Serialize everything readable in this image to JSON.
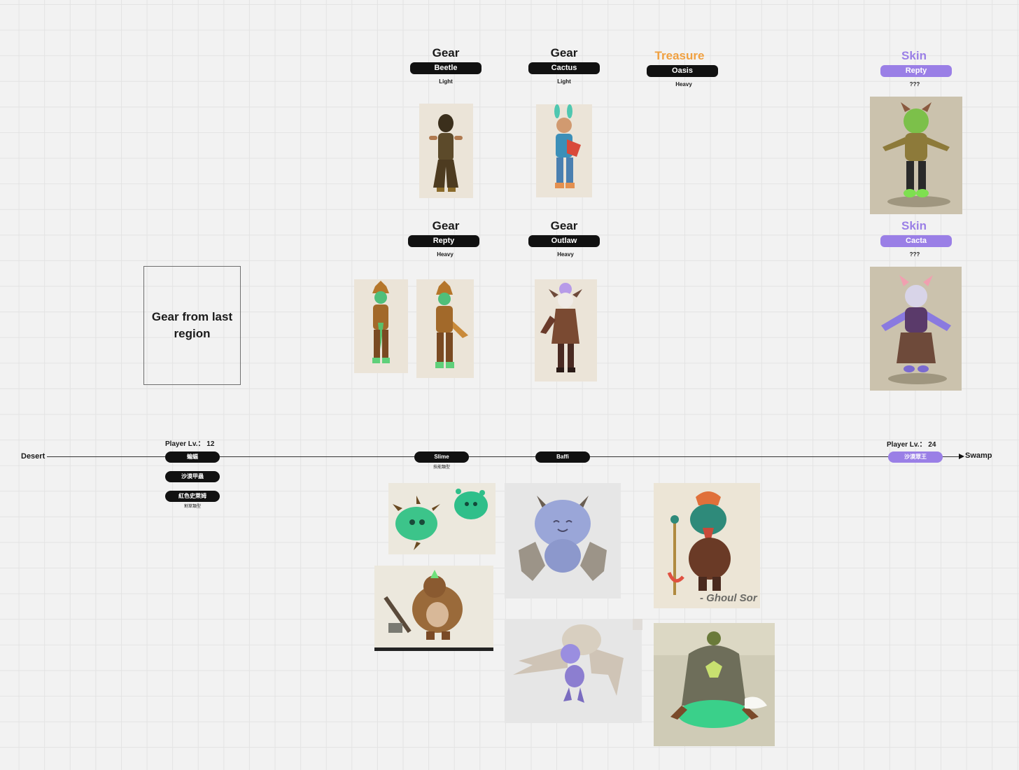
{
  "gear_columns": [
    {
      "category": "Gear",
      "name": "Beetle",
      "weight": "Light"
    },
    {
      "category": "Gear",
      "name": "Cactus",
      "weight": "Light"
    },
    {
      "category": "Treasure",
      "name": "Oasis",
      "weight": "Heavy"
    },
    {
      "category": "Skin",
      "name": "Repty",
      "weight": "???"
    }
  ],
  "gear_row2": [
    {
      "category": "Gear",
      "name": "Repty",
      "weight": "Heavy"
    },
    {
      "category": "Gear",
      "name": "Outlaw",
      "weight": "Heavy"
    },
    {
      "category": "Skin",
      "name": "Cacta",
      "weight": "???"
    }
  ],
  "note_box": "Gear from last region",
  "timeline": {
    "start_label": "Desert",
    "end_label": "Swamp",
    "player_level_left": "Player Lv.： 12",
    "player_level_right": "Player Lv.： 24",
    "left_monsters": [
      "蝙蝠",
      "沙漠甲蟲",
      "紅色史萊姆"
    ],
    "left_note": "割草類型",
    "middle_monsters": [
      "Slime",
      "Baffi"
    ],
    "slime_note": "技能類型",
    "boss": "沙漠眾王"
  },
  "image_caption": "- Ghoul Sor",
  "colors": {
    "treasure": "#f0a040",
    "skin": "#9a7fe6",
    "pill_dark": "#111111"
  }
}
